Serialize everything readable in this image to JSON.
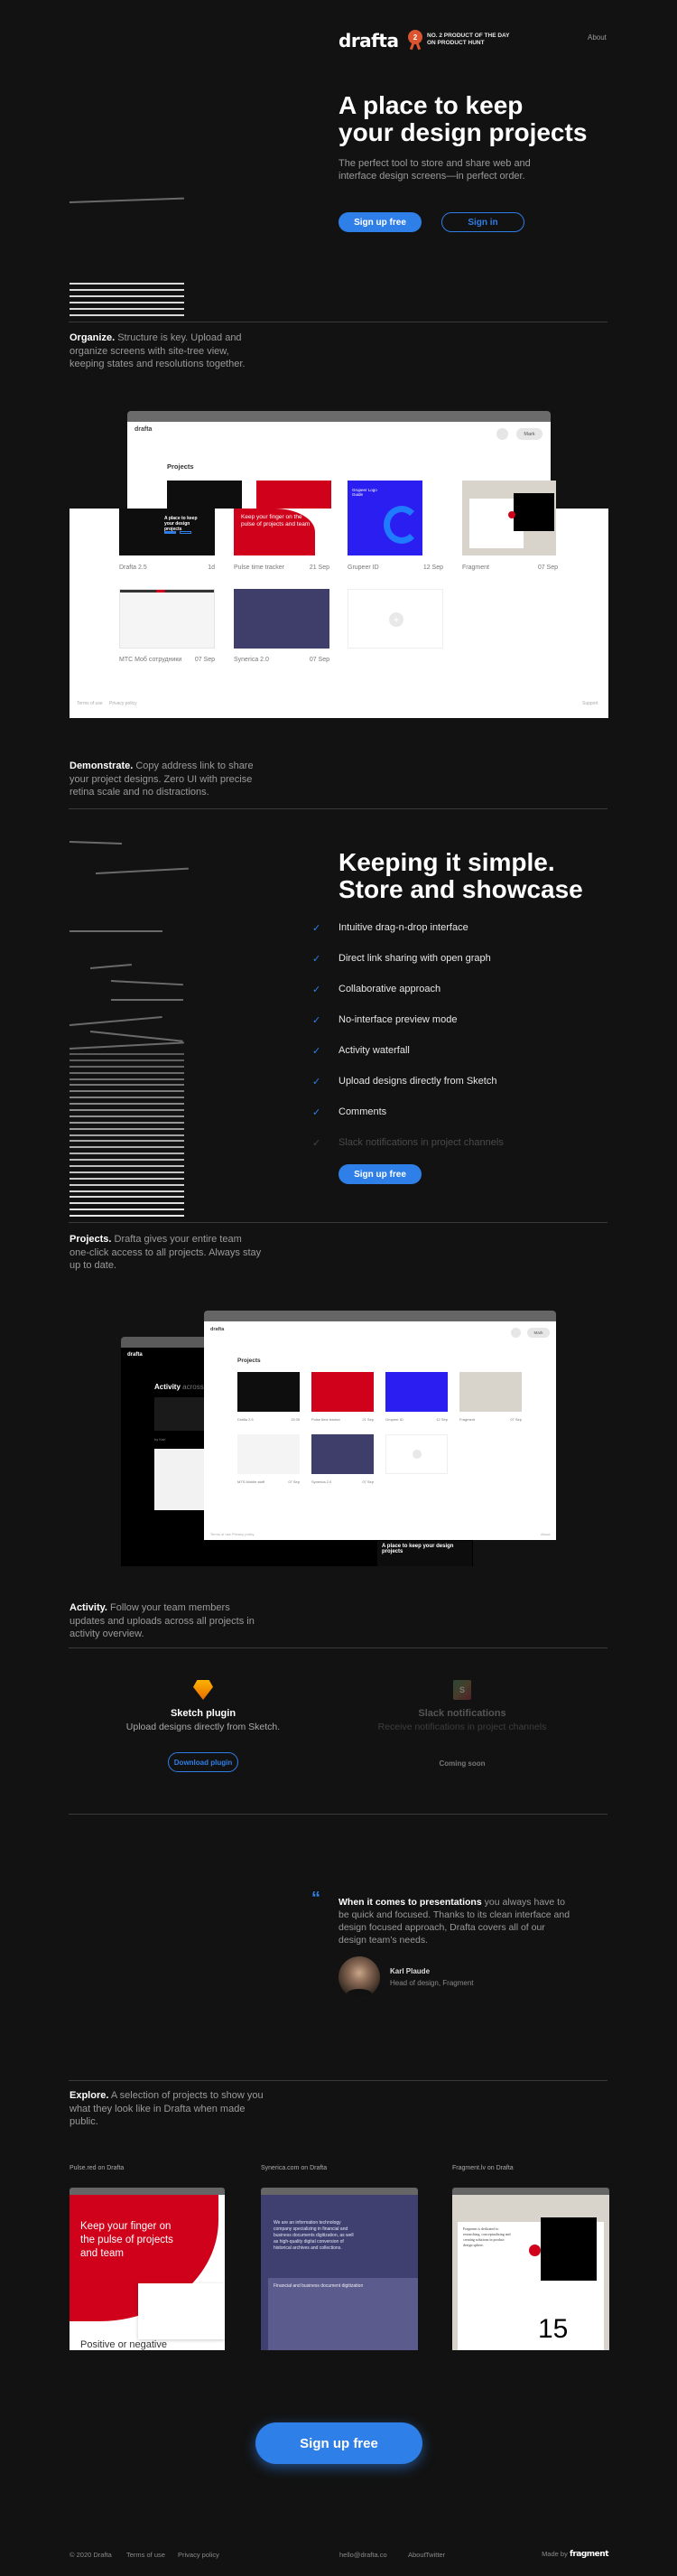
{
  "header": {
    "logo": "drafta",
    "badge_number": "2",
    "badge_line1": "NO. 2 PRODUCT OF THE DAY",
    "badge_line2": "ON PRODUCT HUNT",
    "nav_about": "About"
  },
  "hero": {
    "title_line1": "A place to keep",
    "title_line2": "your design projects",
    "subtitle_line1": "The perfect tool to store and share web and",
    "subtitle_line2": "interface design screens—in perfect order.",
    "signup_label": "Sign up free",
    "signin_label": "Sign in"
  },
  "organize": {
    "title": "Organize.",
    "text": "Structure is key. Upload and organize screens with site-tree view, keeping states and resolutions together."
  },
  "app_preview": {
    "logo": "drafta",
    "user_button": "Mark",
    "projects_heading": "Projects",
    "projects": [
      {
        "name": "Drafta 2.5",
        "date": "1d"
      },
      {
        "name": "Pulse time tracker",
        "date": "21 Sep"
      },
      {
        "name": "Grupeer ID",
        "date": "12 Sep"
      },
      {
        "name": "Fragment",
        "date": "07 Sep"
      },
      {
        "name": "МТС Моб сотрудники",
        "date": "07 Sep"
      },
      {
        "name": "Synerica 2.0",
        "date": "07 Sep"
      }
    ],
    "thumb_drafta_title": "A place to keep your design projects",
    "thumb_pulse_title": "Keep your finger on the pulse of projects and team",
    "thumb_grupeer_title": "Grupeer Logo Guide",
    "footer_terms": "Terms of use",
    "footer_privacy": "Privacy policy",
    "footer_support": "Support"
  },
  "demonstrate": {
    "title": "Demonstrate.",
    "text": "Copy address link to share your project designs. Zero UI with precise retina scale and no distractions."
  },
  "features": {
    "title_line1": "Keeping it simple.",
    "title_line2": "Store and showcase",
    "items": [
      {
        "label": "Intuitive drag-n-drop interface",
        "enabled": true
      },
      {
        "label": "Direct link sharing with open graph",
        "enabled": true
      },
      {
        "label": "Collaborative approach",
        "enabled": true
      },
      {
        "label": "No-interface preview mode",
        "enabled": true
      },
      {
        "label": "Activity waterfall",
        "enabled": true
      },
      {
        "label": "Upload designs directly from Sketch",
        "enabled": true
      },
      {
        "label": "Comments",
        "enabled": true
      },
      {
        "label": "Slack notifications in project channels",
        "enabled": false
      }
    ],
    "signup_label": "Sign up free"
  },
  "projects_section": {
    "title": "Projects.",
    "text": "Drafta gives your entire team one-click access to all projects. Always stay up to date."
  },
  "activity_preview": {
    "back_logo": "drafta",
    "activity_heading_bold": "Activity",
    "activity_heading_rest": "across pr",
    "by_label": "by Karl",
    "front_logo": "drafta",
    "user_button": "Mark",
    "projects_heading": "Projects",
    "projects": [
      {
        "name": "Drafta 2.5",
        "date": "13:39"
      },
      {
        "name": "Pulse time tracker",
        "date": "21 Sep"
      },
      {
        "name": "Grupeer ID",
        "date": "12 Sep"
      },
      {
        "name": "Fragment",
        "date": "07 Sep"
      },
      {
        "name": "MTS Mobile staff",
        "date": "07 Sep"
      },
      {
        "name": "Synerica 2.0",
        "date": "07 Sep"
      }
    ],
    "footer_terms": "Terms of use",
    "footer_privacy": "Privacy policy",
    "footer_about": "About",
    "bottom_card_title": "A place to keep your design projects"
  },
  "activity_section": {
    "title": "Activity.",
    "text": "Follow your team members updates and uploads across all projects in activity overview."
  },
  "integrations": [
    {
      "icon": "sketch-icon",
      "title": "Sketch plugin",
      "text": "Upload designs directly from Sketch.",
      "action": "Download plugin",
      "available": true
    },
    {
      "icon": "slack-icon",
      "title": "Slack notifications",
      "text": "Receive notifications in project channels",
      "action": "Coming soon",
      "available": false
    }
  ],
  "testimonial": {
    "quote_bold": "When it comes to presentations",
    "quote_rest": " you always have to be quick and focused. Thanks to its clean interface and design focused approach, Drafta covers all of our design team’s needs.",
    "author": "Karl Plaude",
    "role": "Head of design, Fragment"
  },
  "explore": {
    "title": "Explore.",
    "text": "A selection of projects to show you what they look like in Drafta when made public.",
    "cards": [
      {
        "label": "Pulse.red on Drafta",
        "headline": "Keep your finger on the pulse of projects and team",
        "sub": "Positive or negative"
      },
      {
        "label": "Synerica.com on Drafta",
        "headline": "We are an information technology company specializing in financial and business documents digitization, as well as high-quality digital conversion of historical archives and collections.",
        "sub": "Financial and business document digitization"
      },
      {
        "label": "Fragment.lv on Drafta",
        "headline": "Fragment is dedicated to researching, conceptualizing and creating solutions in product design sphere.",
        "sub": "15"
      }
    ]
  },
  "cta": {
    "label": "Sign up free"
  },
  "footer": {
    "copyright": "© 2020 Drafta",
    "terms": "Terms of use",
    "privacy": "Privacy policy",
    "email": "hello@drafta.co",
    "about": "About",
    "twitter": "Twitter",
    "made_by": "Made by",
    "made_by_brand": "fragment"
  },
  "colors": {
    "background": "#121212",
    "accent": "#2f7fe8",
    "badge": "#da552f"
  }
}
